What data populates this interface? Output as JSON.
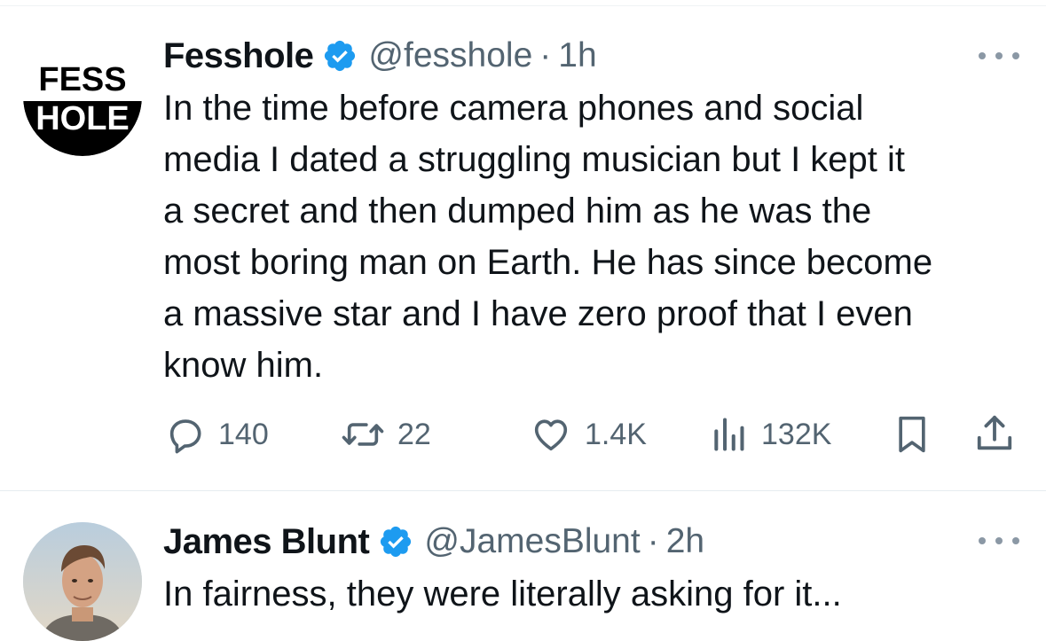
{
  "tweets": [
    {
      "avatar": {
        "lines": [
          "FESS",
          "HOLE"
        ]
      },
      "display_name": "Fesshole",
      "handle": "@fesshole",
      "separator": "·",
      "time": "1h",
      "verified": true,
      "body_lines": [
        "In the time before camera phones and social",
        "media I dated a struggling musician but I kept it",
        "a secret and then dumped him as he was the",
        "most boring man on Earth. He has since become",
        "a massive star and I have zero proof that I even",
        "know him."
      ],
      "actions": {
        "replies": "140",
        "retweets": "22",
        "likes": "1.4K",
        "views": "132K"
      }
    },
    {
      "display_name": "James Blunt",
      "handle": "@JamesBlunt",
      "separator": "·",
      "time": "2h",
      "verified": true,
      "body_lines": [
        "In fairness, they were literally asking for it..."
      ]
    }
  ],
  "icons": {
    "verified": "verified-badge-icon",
    "more": "more-options-icon",
    "reply": "reply-icon",
    "retweet": "retweet-icon",
    "like": "heart-icon",
    "views": "views-icon",
    "bookmark": "bookmark-icon",
    "share": "share-icon"
  },
  "colors": {
    "text": "#0f1419",
    "secondary": "#536471",
    "verified": "#1d9bf0",
    "divider": "#e6ecf0"
  }
}
